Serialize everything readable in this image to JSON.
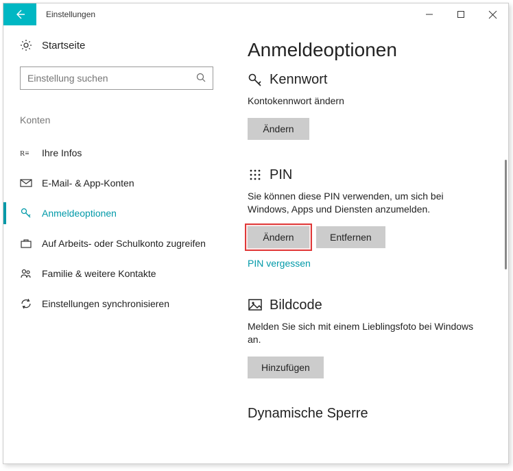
{
  "window": {
    "title": "Einstellungen"
  },
  "sidebar": {
    "home": "Startseite",
    "search_placeholder": "Einstellung suchen",
    "section": "Konten",
    "items": [
      {
        "label": "Ihre Infos"
      },
      {
        "label": "E-Mail- & App-Konten"
      },
      {
        "label": "Anmeldeoptionen"
      },
      {
        "label": "Auf Arbeits- oder Schulkonto zugreifen"
      },
      {
        "label": "Familie & weitere Kontakte"
      },
      {
        "label": "Einstellungen synchronisieren"
      }
    ]
  },
  "main": {
    "title": "Anmeldeoptionen",
    "password": {
      "title": "Kennwort",
      "desc": "Kontokennwort ändern",
      "change": "Ändern"
    },
    "pin": {
      "title": "PIN",
      "desc": "Sie können diese PIN verwenden, um sich bei Windows, Apps und Diensten anzumelden.",
      "change": "Ändern",
      "remove": "Entfernen",
      "forgot": "PIN vergessen"
    },
    "picture": {
      "title": "Bildcode",
      "desc": "Melden Sie sich mit einem Lieblingsfoto bei Windows an.",
      "add": "Hinzufügen"
    },
    "dynamic": {
      "title": "Dynamische Sperre"
    }
  }
}
